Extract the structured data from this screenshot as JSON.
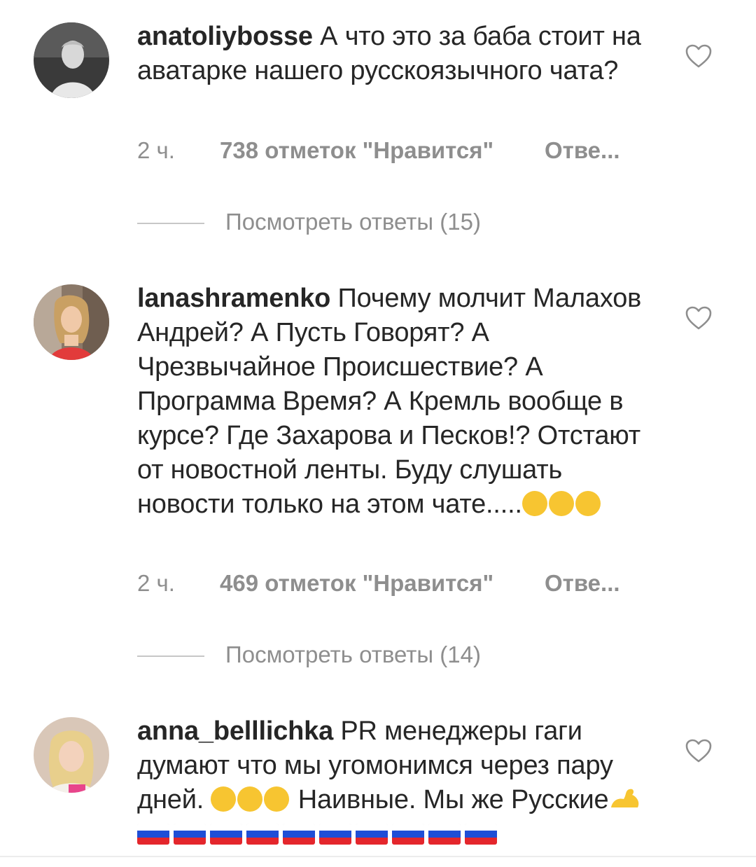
{
  "comments": [
    {
      "username": "anatoliybosse",
      "text": " А что это за баба стоит на аватарке нашего русскоязычного чата?",
      "time": "2 ч.",
      "likes": "738 отметок \"Нравится\"",
      "reply": "Отве...",
      "view_replies": "Посмотреть ответы (15)",
      "avatar_icon": "avatar-photo-icon",
      "heart_icon": "heart-outline-icon"
    },
    {
      "username": "lanashramenko",
      "text": " Почему молчит Малахов Андрей?  А Пусть Говорят? А Чрезвычайное Происшествие? А Программа Время? А Кремль вообще в курсе? Где Захарова и Песков!? Отстают от новостной ленты. Буду слушать новости только на этом чате.....",
      "emoji_tail": [
        "rofl-emoji",
        "grinning-emoji",
        "rofl-emoji"
      ],
      "time": "2 ч.",
      "likes": "469 отметок \"Нравится\"",
      "reply": "Отве...",
      "view_replies": "Посмотреть ответы (14)",
      "avatar_icon": "avatar-photo-icon",
      "heart_icon": "heart-outline-icon"
    },
    {
      "username": "anna_belllichka",
      "text_part1": " PR  менеджеры гаги думают что мы угомонимся через пару дней. ",
      "text_part2": " Наивные. Мы же Русские",
      "emoji_mid": [
        "rofl-emoji",
        "rofl-emoji",
        "rofl-emoji"
      ],
      "emoji_end": [
        "flexed-biceps-emoji",
        "russia-flag-emoji x10"
      ],
      "avatar_icon": "avatar-photo-icon",
      "heart_icon": "heart-outline-icon"
    }
  ],
  "colors": {
    "text": "#262626",
    "meta": "#8e8e8e",
    "divider": "#c7c7c7",
    "emoji": "#f7c531"
  }
}
